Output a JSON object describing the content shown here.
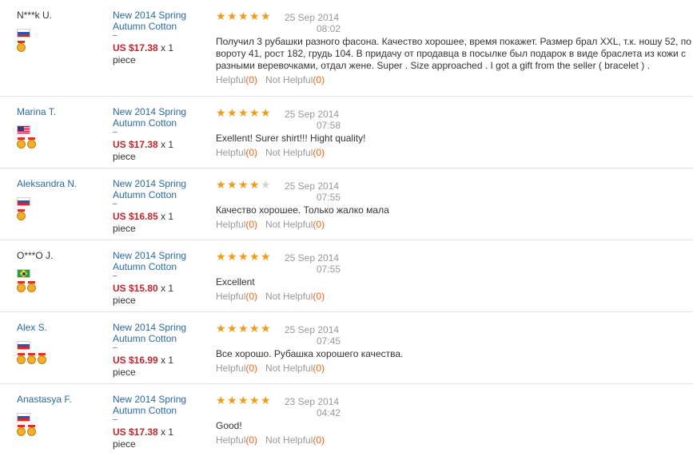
{
  "reviews": [
    {
      "buyer": "N***k U.",
      "buyer_linked": false,
      "flag": "russia-flag",
      "medals": 1,
      "product_line1": "New 2014 Spring",
      "product_line2": "Autumn Cotton",
      "product_dash": "–",
      "price": "US $17.38",
      "qty": "x 1",
      "unit": "piece",
      "rating": 5,
      "date": "25 Sep 2014",
      "time": "08:02",
      "text": "Получил 3 рубашки разного фасона. Качество хорошее, время покажет. Размер брал XXL, т.к. ношу 52, по вороту 41, рост 182, грудь 104. В придачу от продавца в посылке был подарок в виде браслета из кожи с разными веревочками, отдал жене. Super . Size approached . I got a gift from the seller ( bracelet ) .",
      "helpful_label": "Helpful",
      "helpful_count": "(0)",
      "not_helpful_label": "Not Helpful",
      "not_helpful_count": "(0)"
    },
    {
      "buyer": "Marina T.",
      "buyer_linked": true,
      "flag": "usa-flag",
      "medals": 2,
      "product_line1": "New 2014 Spring",
      "product_line2": "Autumn Cotton",
      "product_dash": "–",
      "price": "US $17.38",
      "qty": "x 1",
      "unit": "piece",
      "rating": 5,
      "date": "25 Sep 2014",
      "time": "07:58",
      "text": "Exellent! Surer shirt!!! Hight quality!",
      "helpful_label": "Helpful",
      "helpful_count": "(0)",
      "not_helpful_label": "Not Helpful",
      "not_helpful_count": "(0)"
    },
    {
      "buyer": "Aleksandra N.",
      "buyer_linked": true,
      "flag": "russia-flag",
      "medals": 1,
      "product_line1": "New 2014 Spring",
      "product_line2": "Autumn Cotton",
      "product_dash": "–",
      "price": "US $16.85",
      "qty": "x 1",
      "unit": "piece",
      "rating": 4,
      "date": "25 Sep 2014",
      "time": "07:55",
      "text": "Качество хорошее. Только жалко мала",
      "helpful_label": "Helpful",
      "helpful_count": "(0)",
      "not_helpful_label": "Not Helpful",
      "not_helpful_count": "(0)"
    },
    {
      "buyer": "O***O J.",
      "buyer_linked": false,
      "flag": "brazil-flag",
      "medals": 2,
      "product_line1": "New 2014 Spring",
      "product_line2": "Autumn Cotton",
      "product_dash": "–",
      "price": "US $15.80",
      "qty": "x 1",
      "unit": "piece",
      "rating": 5,
      "date": "25 Sep 2014",
      "time": "07:55",
      "text": "Excellent",
      "helpful_label": "Helpful",
      "helpful_count": "(0)",
      "not_helpful_label": "Not Helpful",
      "not_helpful_count": "(0)"
    },
    {
      "buyer": "Alex S.",
      "buyer_linked": true,
      "flag": "russia-flag",
      "medals": 3,
      "product_line1": "New 2014 Spring",
      "product_line2": "Autumn Cotton",
      "product_dash": "–",
      "price": "US $16.99",
      "qty": "x 1",
      "unit": "piece",
      "rating": 5,
      "date": "25 Sep 2014",
      "time": "07:45",
      "text": "Все хорошо. Рубашка хорошего качества.",
      "helpful_label": "Helpful",
      "helpful_count": "(0)",
      "not_helpful_label": "Not Helpful",
      "not_helpful_count": "(0)"
    },
    {
      "buyer": "Anastasya F.",
      "buyer_linked": true,
      "flag": "russia-flag",
      "medals": 2,
      "product_line1": "New 2014 Spring",
      "product_line2": "Autumn Cotton",
      "product_dash": "–",
      "price": "US $17.38",
      "qty": "x 1",
      "unit": "piece",
      "rating": 5,
      "date": "23 Sep 2014",
      "time": "04:42",
      "text": "Good!",
      "helpful_label": "Helpful",
      "helpful_count": "(0)",
      "not_helpful_label": "Not Helpful",
      "not_helpful_count": "(0)"
    }
  ],
  "colors": {
    "link": "#2b6aa3",
    "price": "#c0272d",
    "star": "#f29b1b",
    "count": "#e06a1a"
  }
}
